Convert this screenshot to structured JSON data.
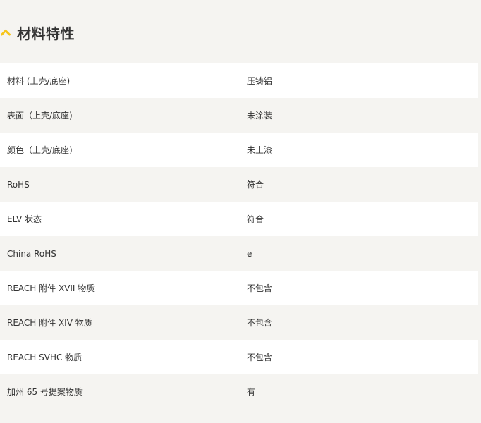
{
  "section": {
    "title": "材料特性",
    "chevron_icon": "chevron-up-icon",
    "accent_color": "#f6c51b"
  },
  "rows": [
    {
      "label": "材料 (上壳/底座)",
      "value": "压铸铝"
    },
    {
      "label": "表面（上壳/底座)",
      "value": "未涂装"
    },
    {
      "label": "颜色（上壳/底座)",
      "value": "未上漆"
    },
    {
      "label": "RoHS",
      "value": "符合"
    },
    {
      "label": "ELV 状态",
      "value": "符合"
    },
    {
      "label": "China RoHS",
      "value": "e"
    },
    {
      "label": "REACH 附件 XVII 物质",
      "value": "不包含"
    },
    {
      "label": "REACH 附件 XIV 物质",
      "value": "不包含"
    },
    {
      "label": "REACH SVHC 物质",
      "value": "不包含"
    },
    {
      "label": "加州 65 号提案物质",
      "value": "有"
    }
  ]
}
